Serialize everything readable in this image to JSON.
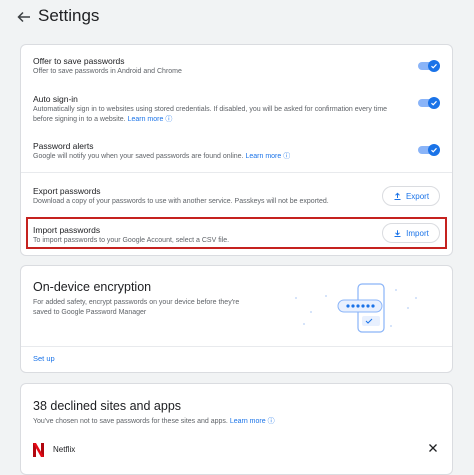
{
  "header": {
    "title": "Settings",
    "back_icon": "arrow-left-icon"
  },
  "passwords_card": {
    "offer": {
      "title": "Offer to save passwords",
      "desc": "Offer to save passwords in Android and Chrome",
      "enabled": true
    },
    "auto_sign_in": {
      "title": "Auto sign-in",
      "desc_line1": "Automatically sign in to websites using stored credentials. If disabled, you will be asked for confirmation every time",
      "desc_line2": "before signing in to a website.",
      "learn_more": "Learn more",
      "enabled": true
    },
    "alerts": {
      "title": "Password alerts",
      "desc": "Google will notify you when your saved passwords are found online.",
      "learn_more": "Learn more",
      "enabled": true
    },
    "export": {
      "title": "Export passwords",
      "desc": "Download a copy of your passwords to use with another service. Passkeys will not be exported.",
      "button": "Export"
    },
    "import": {
      "title": "Import passwords",
      "desc": "To import passwords to your Google Account, select a CSV file.",
      "button": "Import"
    }
  },
  "encryption_card": {
    "title": "On-device encryption",
    "desc_line1": "For added safety, encrypt passwords on your device before they're",
    "desc_line2": "saved to Google Password Manager",
    "setup": "Set up"
  },
  "declined_card": {
    "title": "38 declined sites and apps",
    "desc": "You've chosen not to save passwords for these sites and apps.",
    "learn_more": "Learn more",
    "items": [
      {
        "name": "Netflix"
      }
    ]
  },
  "colors": {
    "accent": "#1a73e8",
    "highlight": "#c5221f",
    "netflix": "#e50914"
  }
}
